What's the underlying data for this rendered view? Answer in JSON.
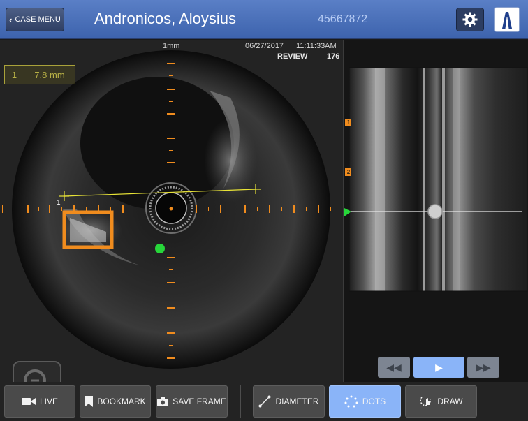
{
  "header": {
    "case_menu_label": "CASE MENU",
    "patient_name": "Andronicos, Aloysius",
    "patient_id": "45667872"
  },
  "image_info": {
    "scale_label": "1mm",
    "date": "06/27/2017",
    "time": "11:11:33AM",
    "mode": "REVIEW",
    "frame": "176"
  },
  "measurement": {
    "index": "1",
    "value": "7.8 mm",
    "line_label": "1"
  },
  "longitudinal": {
    "bookmarks": [
      "1",
      "2"
    ]
  },
  "playback": {
    "rewind_icon": "rewind-icon",
    "play_icon": "play-icon",
    "forward_icon": "fast-forward-icon"
  },
  "toolbar": {
    "live_label": "LIVE",
    "bookmark_label": "BOOKMARK",
    "save_frame_label": "SAVE FRAME",
    "diameter_label": "DIAMETER",
    "dots_label": "DOTS",
    "draw_label": "DRAW"
  },
  "colors": {
    "header": "#4a70b8",
    "accent": "#8ab4f8",
    "roi": "#f08c1e",
    "measure_line": "#e8e337",
    "marker": "#27d63a"
  }
}
